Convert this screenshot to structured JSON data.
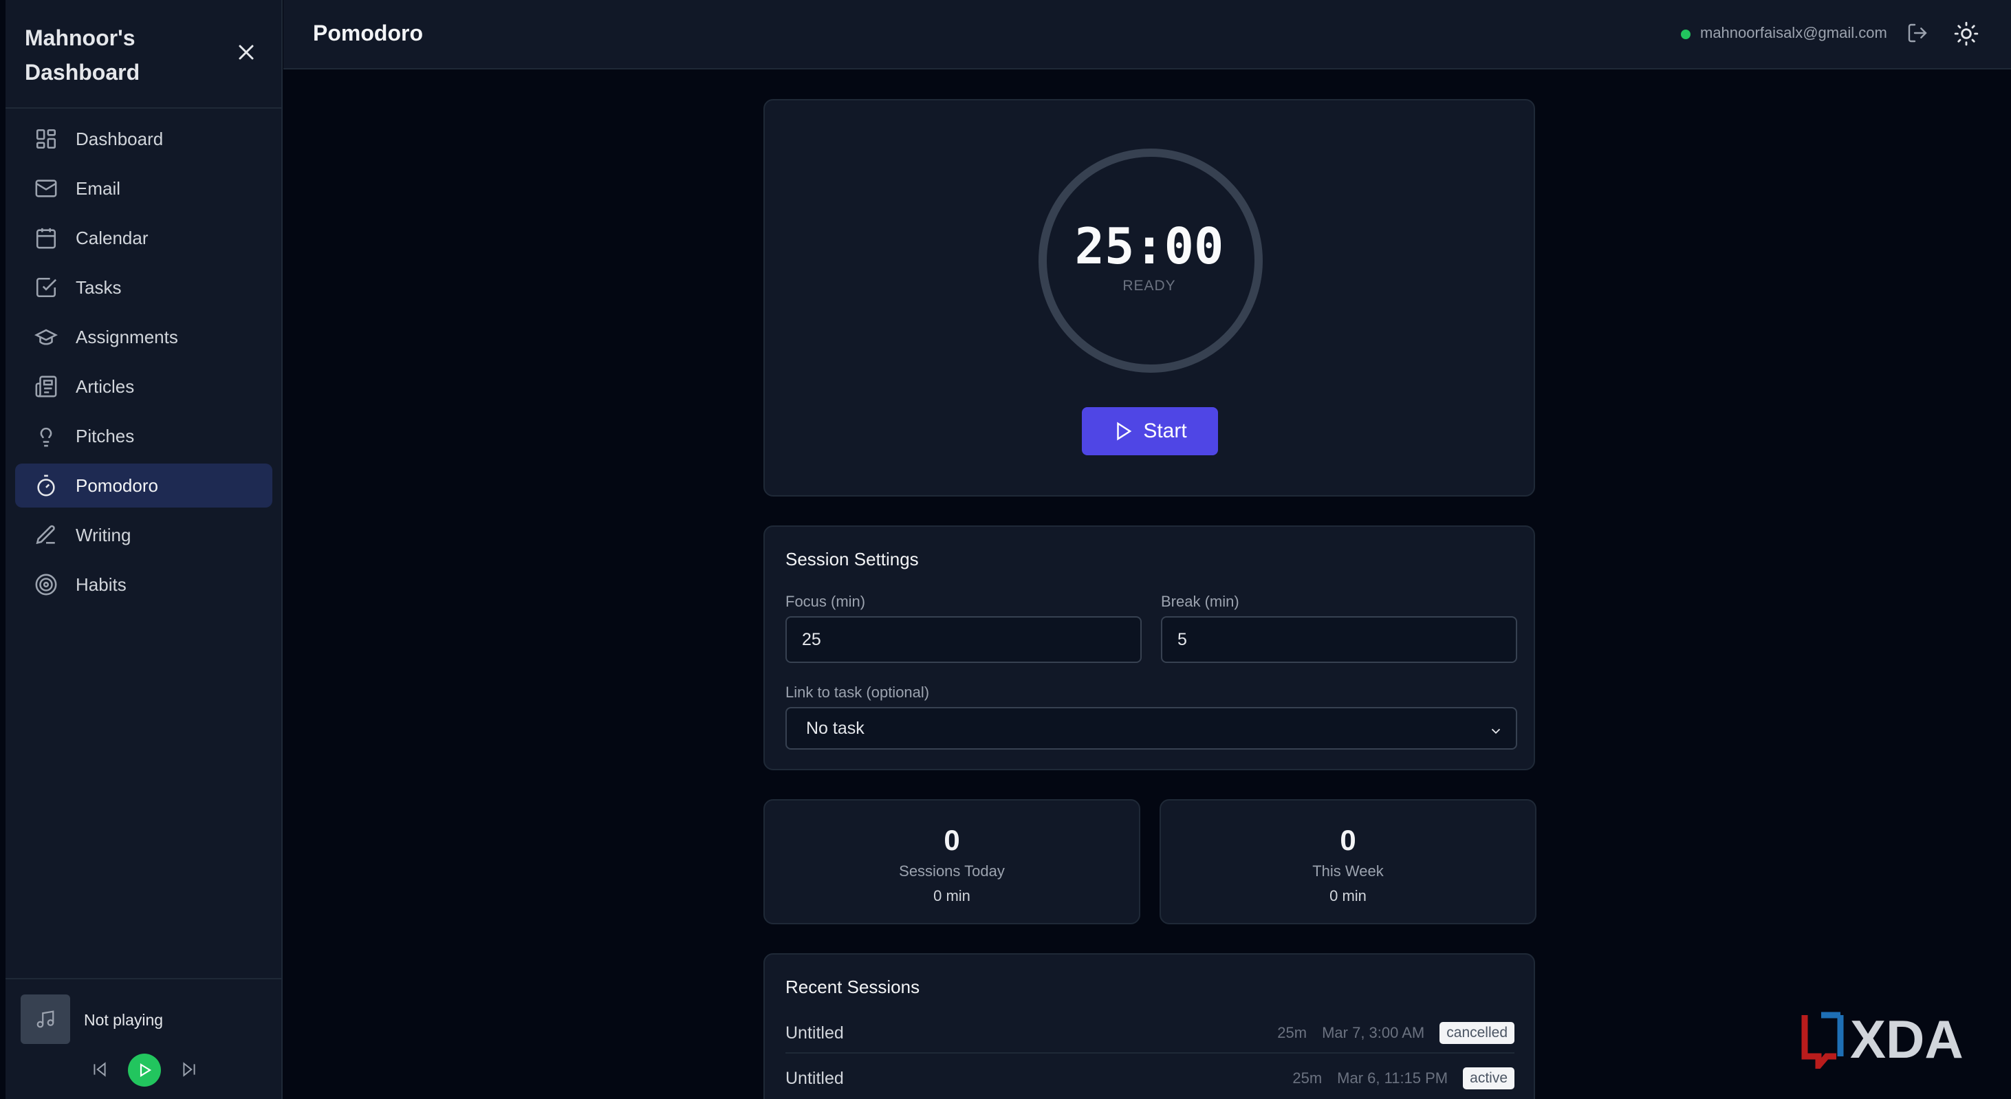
{
  "sidebar": {
    "title": "Mahnoor's Dashboard",
    "items": [
      {
        "label": "Dashboard",
        "icon": "dashboard-icon"
      },
      {
        "label": "Email",
        "icon": "mail-icon"
      },
      {
        "label": "Calendar",
        "icon": "calendar-icon"
      },
      {
        "label": "Tasks",
        "icon": "checkbox-icon"
      },
      {
        "label": "Assignments",
        "icon": "graduation-cap-icon"
      },
      {
        "label": "Articles",
        "icon": "newspaper-icon"
      },
      {
        "label": "Pitches",
        "icon": "lightbulb-icon"
      },
      {
        "label": "Pomodoro",
        "icon": "timer-icon",
        "active": true
      },
      {
        "label": "Writing",
        "icon": "pen-icon"
      },
      {
        "label": "Habits",
        "icon": "target-icon"
      }
    ],
    "player": {
      "status": "Not playing"
    }
  },
  "header": {
    "title": "Pomodoro",
    "email": "mahnoorfaisalx@gmail.com"
  },
  "timer": {
    "time": "25:00",
    "state": "READY",
    "start_label": "Start"
  },
  "settings": {
    "title": "Session Settings",
    "focus_label": "Focus (min)",
    "focus_value": "25",
    "break_label": "Break (min)",
    "break_value": "5",
    "task_label": "Link to task (optional)",
    "task_value": "No task"
  },
  "stats": [
    {
      "value": "0",
      "label": "Sessions Today",
      "sub": "0 min"
    },
    {
      "value": "0",
      "label": "This Week",
      "sub": "0 min"
    }
  ],
  "recent": {
    "title": "Recent Sessions",
    "rows": [
      {
        "name": "Untitled",
        "duration": "25m",
        "date": "Mar 7, 3:00 AM",
        "status": "cancelled"
      },
      {
        "name": "Untitled",
        "duration": "25m",
        "date": "Mar 6, 11:15 PM",
        "status": "active"
      }
    ]
  },
  "watermark": {
    "text": "XDA"
  },
  "colors": {
    "accent": "#4f46e5",
    "online": "#22c55e",
    "active_nav": "#1e2a52"
  }
}
